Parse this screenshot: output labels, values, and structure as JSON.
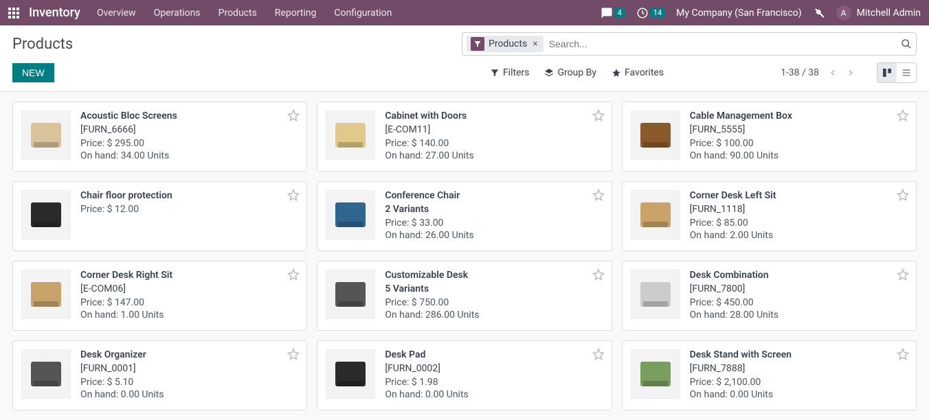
{
  "header": {
    "brand": "Inventory",
    "nav": [
      "Overview",
      "Operations",
      "Products",
      "Reporting",
      "Configuration"
    ],
    "msg_badge": "4",
    "activity_badge": "14",
    "company": "My Company (San Francisco)",
    "user_initial": "A",
    "user_name": "Mitchell Admin"
  },
  "page": {
    "title": "Products",
    "filter_chip": "Products",
    "search_placeholder": "Search...",
    "new_label": "NEW",
    "filters_label": "Filters",
    "groupby_label": "Group By",
    "favorites_label": "Favorites",
    "pager": "1-38 / 38"
  },
  "products": [
    {
      "name": "Acoustic Bloc Screens",
      "ref": "[FURN_6666]",
      "price": "Price: $ 295.00",
      "onhand": "On hand: 34.00 Units"
    },
    {
      "name": "Cabinet with Doors",
      "ref": "[E-COM11]",
      "price": "Price: $ 140.00",
      "onhand": "On hand: 27.00 Units"
    },
    {
      "name": "Cable Management Box",
      "ref": "[FURN_5555]",
      "price": "Price: $ 100.00",
      "onhand": "On hand: 90.00 Units"
    },
    {
      "name": "Chair floor protection",
      "ref": "",
      "price": "Price: $ 12.00",
      "onhand": ""
    },
    {
      "name": "Conference Chair",
      "ref": "",
      "variants": "2 Variants",
      "price": "Price: $ 33.00",
      "onhand": "On hand: 26.00 Units"
    },
    {
      "name": "Corner Desk Left Sit",
      "ref": "[FURN_1118]",
      "price": "Price: $ 85.00",
      "onhand": "On hand: 2.00 Units"
    },
    {
      "name": "Corner Desk Right Sit",
      "ref": "[E-COM06]",
      "price": "Price: $ 147.00",
      "onhand": "On hand: 1.00 Units"
    },
    {
      "name": "Customizable Desk",
      "ref": "",
      "variants": "5 Variants",
      "price": "Price: $ 750.00",
      "onhand": "On hand: 286.00 Units"
    },
    {
      "name": "Desk Combination",
      "ref": "[FURN_7800]",
      "price": "Price: $ 450.00",
      "onhand": "On hand: 28.00 Units"
    },
    {
      "name": "Desk Organizer",
      "ref": "[FURN_0001]",
      "price": "Price: $ 5.10",
      "onhand": "On hand: 0.00 Units"
    },
    {
      "name": "Desk Pad",
      "ref": "[FURN_0002]",
      "price": "Price: $ 1.98",
      "onhand": "On hand: 0.00 Units"
    },
    {
      "name": "Desk Stand with Screen",
      "ref": "[FURN_7888]",
      "price": "Price: $ 2,100.00",
      "onhand": "On hand: 0.00 Units"
    }
  ],
  "thumbs": {
    "colors": [
      "#d9c39a",
      "#e0c98a",
      "#8b5a2b",
      "#2a2a2a",
      "#2f6690",
      "#c9a36a",
      "#c9a36a",
      "#555",
      "#ccc",
      "#555",
      "#2a2a2a",
      "#7a9e5e"
    ]
  }
}
